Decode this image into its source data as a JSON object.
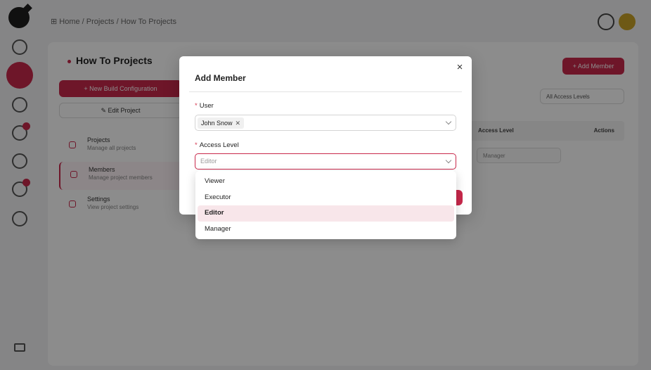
{
  "background": {
    "breadcrumb": "⊞ Home / Projects / How To Projects",
    "page_title": "How To Projects",
    "add_member_button": "+ Add Member",
    "new_build_button": "+ New Build Configuration",
    "edit_project_button": "✎ Edit Project",
    "menu": [
      {
        "title": "Projects",
        "subtitle": "Manage all projects"
      },
      {
        "title": "Members",
        "subtitle": "Manage project members"
      },
      {
        "title": "Settings",
        "subtitle": "View project settings"
      }
    ],
    "filter": "All Access Levels",
    "table_headers": {
      "access": "Access Level",
      "actions": "Actions"
    },
    "row_role": "Manager"
  },
  "modal": {
    "title": "Add Member",
    "close_icon": "×",
    "user_label": "User",
    "user_value": "John Snow",
    "access_label": "Access Level",
    "access_placeholder": "Editor",
    "required_mark": "*"
  },
  "dropdown": {
    "options": [
      "Viewer",
      "Executor",
      "Editor",
      "Manager"
    ],
    "selected": "Editor"
  },
  "colors": {
    "accent": "#c8284b",
    "selected_bg": "#f8e6ea"
  }
}
